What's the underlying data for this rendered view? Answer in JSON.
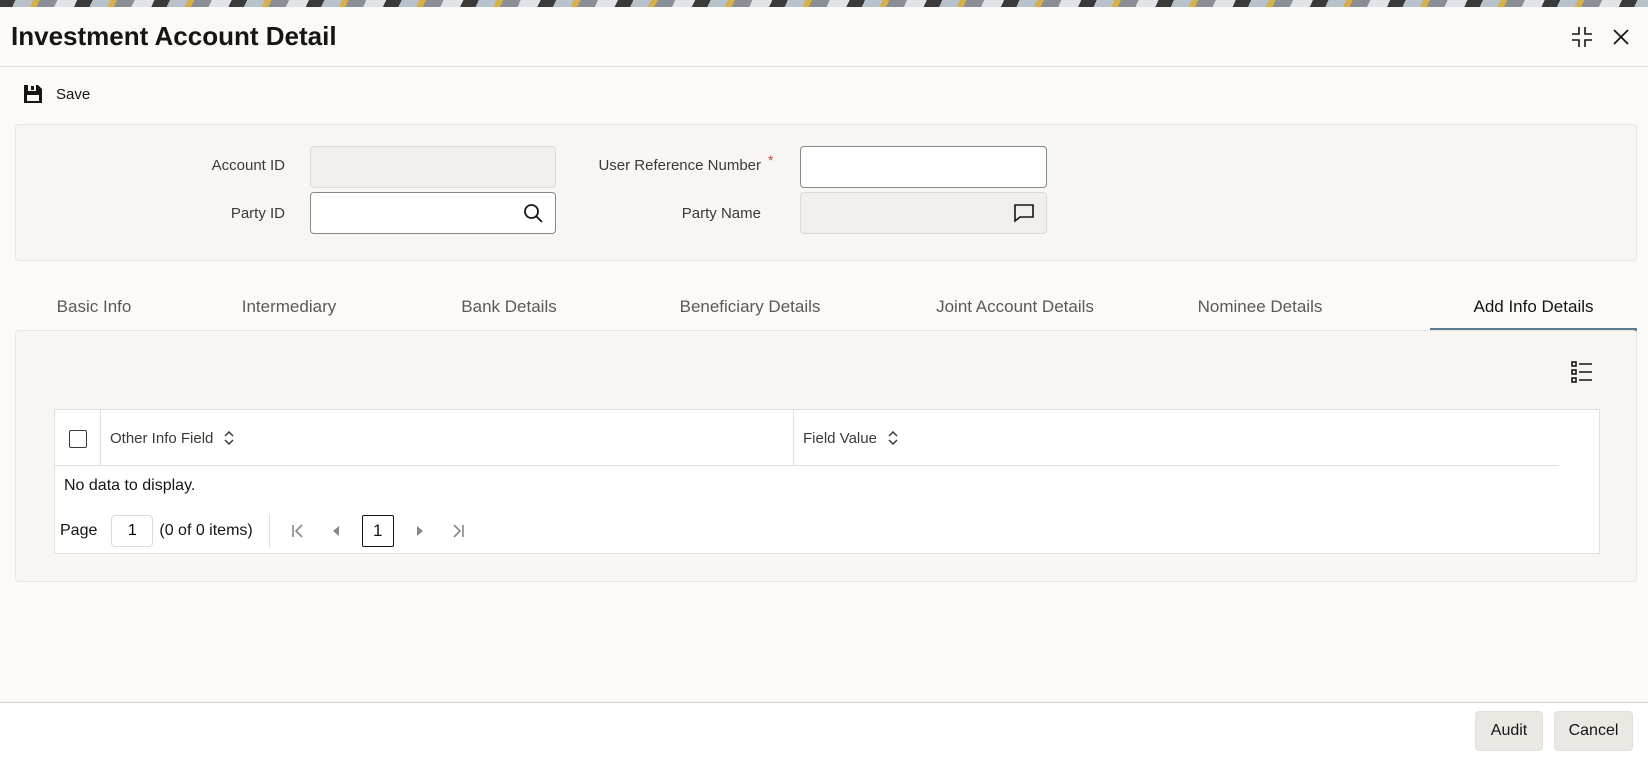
{
  "window": {
    "title": "Investment Account Detail"
  },
  "toolbar": {
    "save_label": "Save"
  },
  "header": {
    "account_id_label": "Account ID",
    "account_id_value": "",
    "party_id_label": "Party ID",
    "party_id_value": "",
    "user_ref_label": "User Reference Number",
    "user_ref_required": "*",
    "user_ref_value": "",
    "party_name_label": "Party Name",
    "party_name_value": ""
  },
  "tabs": [
    {
      "label": "Basic Info",
      "active": false
    },
    {
      "label": "Intermediary",
      "active": false
    },
    {
      "label": "Bank Details",
      "active": false
    },
    {
      "label": "Beneficiary Details",
      "active": false
    },
    {
      "label": "Joint Account Details",
      "active": false
    },
    {
      "label": "Nominee Details",
      "active": false
    },
    {
      "label": "Add Info Details",
      "active": true
    }
  ],
  "grid": {
    "columns": [
      "Other Info Field",
      "Field Value"
    ],
    "empty_text": "No data to display.",
    "pager": {
      "page_label": "Page",
      "page_value": "1",
      "items_text": "(0 of 0 items)",
      "current_page": "1"
    }
  },
  "footer": {
    "audit_label": "Audit",
    "cancel_label": "Cancel"
  },
  "colors": {
    "accent": "#5b7b93",
    "required": "#c74634",
    "panel": "#f8f6f3"
  },
  "icons": [
    "maximize-icon",
    "close-icon",
    "save-icon",
    "search-icon",
    "comment-icon",
    "column-list-icon",
    "sort-icon",
    "first-page-icon",
    "prev-page-icon",
    "next-page-icon",
    "last-page-icon"
  ]
}
